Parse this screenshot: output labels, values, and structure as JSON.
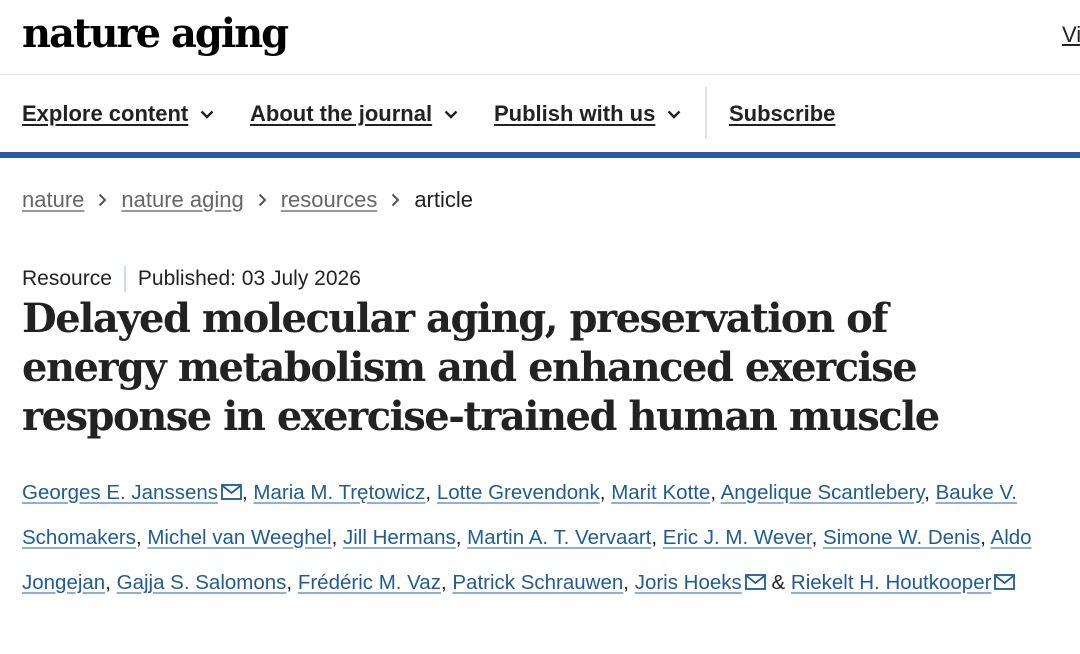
{
  "header": {
    "logo": "nature aging",
    "right_link": "Vi"
  },
  "nav": {
    "items": [
      {
        "label": "Explore content",
        "has_dropdown": true
      },
      {
        "label": "About the journal",
        "has_dropdown": true
      },
      {
        "label": "Publish with us",
        "has_dropdown": true
      },
      {
        "label": "Subscribe",
        "has_dropdown": false
      }
    ]
  },
  "breadcrumb": {
    "items": [
      "nature",
      "nature aging",
      "resources"
    ],
    "current": "article"
  },
  "article": {
    "type": "Resource",
    "published": "Published: 03 July 2026",
    "title": "Delayed molecular aging, preservation of energy metabolism and enhanced exercise response in exercise-trained human muscle",
    "authors": [
      {
        "name": "Georges E. Janssens",
        "mail": true
      },
      {
        "name": "Maria M. Trętowicz",
        "mail": false
      },
      {
        "name": "Lotte Grevendonk",
        "mail": false
      },
      {
        "name": "Marit Kotte",
        "mail": false
      },
      {
        "name": "Angelique Scantlebery",
        "mail": false
      },
      {
        "name": "Bauke V. Schomakers",
        "mail": false
      },
      {
        "name": "Michel van Weeghel",
        "mail": false
      },
      {
        "name": "Jill Hermans",
        "mail": false
      },
      {
        "name": "Martin A. T. Vervaart",
        "mail": false
      },
      {
        "name": "Eric J. M. Wever",
        "mail": false
      },
      {
        "name": "Simone W. Denis",
        "mail": false
      },
      {
        "name": "Aldo Jongejan",
        "mail": false
      },
      {
        "name": "Gajja S. Salomons",
        "mail": false
      },
      {
        "name": "Frédéric M. Vaz",
        "mail": false
      },
      {
        "name": "Patrick Schrauwen",
        "mail": false
      },
      {
        "name": "Joris Hoeks",
        "mail": true
      },
      {
        "name": "Riekelt H. Houtkooper",
        "mail": true
      }
    ],
    "ampersand": "&"
  },
  "colors": {
    "accent": "#2a5ba0",
    "link": "#1f5c94"
  }
}
